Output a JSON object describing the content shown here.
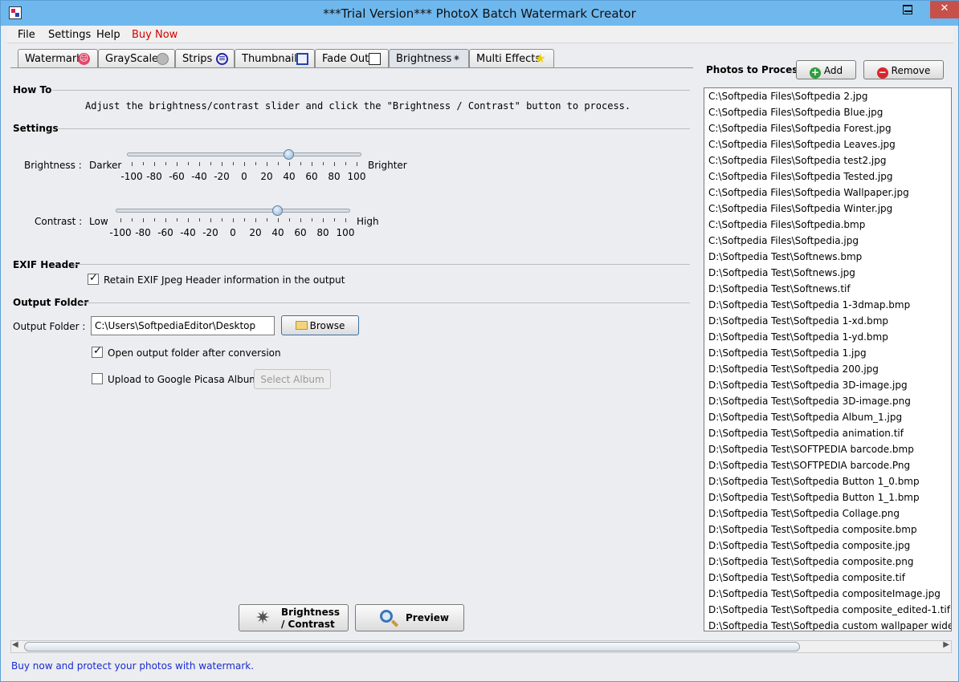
{
  "window": {
    "title": "***Trial Version*** PhotoX Batch Watermark Creator"
  },
  "menu": {
    "items": [
      "File",
      "Settings",
      "Help",
      "Buy Now"
    ]
  },
  "tabs": [
    {
      "label": "Watermark",
      "icon": "no-entry-icon"
    },
    {
      "label": "GrayScale",
      "icon": "grayscale-icon"
    },
    {
      "label": "Strips",
      "icon": "strips-icon"
    },
    {
      "label": "Thumbnail",
      "icon": "thumbnail-icon"
    },
    {
      "label": "Fade Out",
      "icon": "fade-out-icon"
    },
    {
      "label": "Brightness",
      "icon": "brightness-icon",
      "active": true
    },
    {
      "label": "Multi Effects",
      "icon": "star-icon"
    }
  ],
  "howto": {
    "title": "How To",
    "text": "Adjust the brightness/contrast slider and click the \"Brightness / Contrast\" button to process."
  },
  "settings": {
    "title": "Settings",
    "brightness": {
      "label": "Brightness :",
      "left": "Darker",
      "right": "Brighter",
      "value": 40,
      "range": [
        -100,
        100
      ],
      "ticks": [
        "-100",
        "-80",
        "-60",
        "-40",
        "-20",
        "0",
        "20",
        "40",
        "60",
        "80",
        "100"
      ]
    },
    "contrast": {
      "label": "Contrast :",
      "left": "Low",
      "right": "High",
      "value": 40,
      "range": [
        -100,
        100
      ],
      "ticks": [
        "-100",
        "-80",
        "-60",
        "-40",
        "-20",
        "0",
        "20",
        "40",
        "60",
        "80",
        "100"
      ]
    }
  },
  "exif": {
    "title": "EXIF Header",
    "retain_label": "Retain EXIF Jpeg Header information in the output",
    "retain_checked": true
  },
  "output": {
    "title": "Output Folder",
    "folder_label": "Output Folder :",
    "folder_value": "C:\\Users\\SoftpediaEditor\\Desktop",
    "browse_label": "Browse",
    "open_folder_label": "Open output folder after conversion",
    "open_folder_checked": true,
    "picasa_label": "Upload to Google Picasa Album",
    "picasa_checked": false,
    "select_album_label": "Select Album"
  },
  "actions": {
    "brightness_line1": "Brightness",
    "brightness_line2": "/ Contrast",
    "preview_label": "Preview"
  },
  "photos": {
    "title": "Photos to Process",
    "add_label": "Add",
    "remove_label": "Remove",
    "items": [
      "C:\\Softpedia Files\\Softpedia 2.jpg",
      "C:\\Softpedia Files\\Softpedia Blue.jpg",
      "C:\\Softpedia Files\\Softpedia Forest.jpg",
      "C:\\Softpedia Files\\Softpedia Leaves.jpg",
      "C:\\Softpedia Files\\Softpedia test2.jpg",
      "C:\\Softpedia Files\\Softpedia Tested.jpg",
      "C:\\Softpedia Files\\Softpedia Wallpaper.jpg",
      "C:\\Softpedia Files\\Softpedia Winter.jpg",
      "C:\\Softpedia Files\\Softpedia.bmp",
      "C:\\Softpedia Files\\Softpedia.jpg",
      "D:\\Softpedia Test\\Softnews.bmp",
      "D:\\Softpedia Test\\Softnews.jpg",
      "D:\\Softpedia Test\\Softnews.tif",
      "D:\\Softpedia Test\\Softpedia 1-3dmap.bmp",
      "D:\\Softpedia Test\\Softpedia 1-xd.bmp",
      "D:\\Softpedia Test\\Softpedia 1-yd.bmp",
      "D:\\Softpedia Test\\Softpedia 1.jpg",
      "D:\\Softpedia Test\\Softpedia 200.jpg",
      "D:\\Softpedia Test\\Softpedia 3D-image.jpg",
      "D:\\Softpedia Test\\Softpedia 3D-image.png",
      "D:\\Softpedia Test\\Softpedia Album_1.jpg",
      "D:\\Softpedia Test\\Softpedia animation.tif",
      "D:\\Softpedia Test\\SOFTPEDIA barcode.bmp",
      "D:\\Softpedia Test\\SOFTPEDIA barcode.Png",
      "D:\\Softpedia Test\\Softpedia Button 1_0.bmp",
      "D:\\Softpedia Test\\Softpedia Button 1_1.bmp",
      "D:\\Softpedia Test\\Softpedia Collage.png",
      "D:\\Softpedia Test\\Softpedia composite.bmp",
      "D:\\Softpedia Test\\Softpedia composite.jpg",
      "D:\\Softpedia Test\\Softpedia composite.png",
      "D:\\Softpedia Test\\Softpedia composite.tif",
      "D:\\Softpedia Test\\Softpedia compositeImage.jpg",
      "D:\\Softpedia Test\\Softpedia composite_edited-1.tif",
      "D:\\Softpedia Test\\Softpedia custom wallpaper wide.jpg"
    ]
  },
  "status": {
    "text": "Buy now and protect your photos with watermark."
  },
  "colors": {
    "titlebar": "#6fb8ee",
    "close": "#c7514a",
    "buy_now": "#d40000",
    "status_text": "#1a2acf"
  }
}
